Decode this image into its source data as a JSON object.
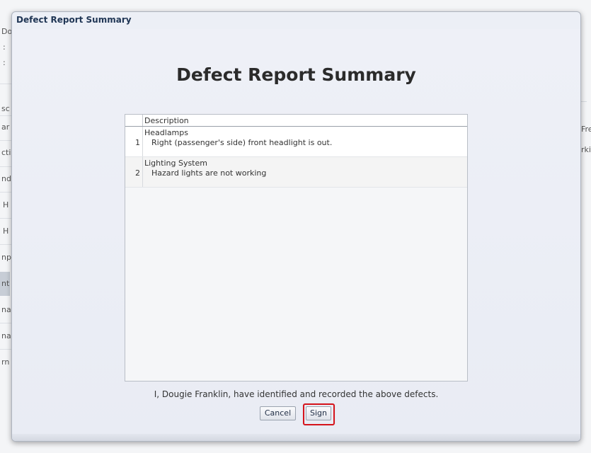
{
  "dialog": {
    "title": "Defect Report Summary",
    "heading": "Defect Report Summary"
  },
  "table": {
    "columns": [
      "",
      "Description"
    ],
    "rows": [
      {
        "number": "1",
        "category": "Headlamps",
        "description": "Right (passenger's side) front headlight is out."
      },
      {
        "number": "2",
        "category": "Lighting System",
        "description": "Hazard lights are not working"
      }
    ]
  },
  "statement": "I, Dougie Franklin, have identified and recorded the above defects.",
  "buttons": {
    "cancel_label": "Cancel",
    "sign_label": "Sign"
  },
  "background_fragments": {
    "left": [
      "Do",
      ":",
      ":",
      "sc",
      "ar",
      "cti",
      "nd",
      "H",
      "H",
      "np",
      "nt",
      "na",
      "na",
      "rn"
    ],
    "right": [
      "Fre",
      "rki"
    ]
  },
  "colors": {
    "highlight_border": "#d6141c",
    "title_text": "#1f3554"
  }
}
